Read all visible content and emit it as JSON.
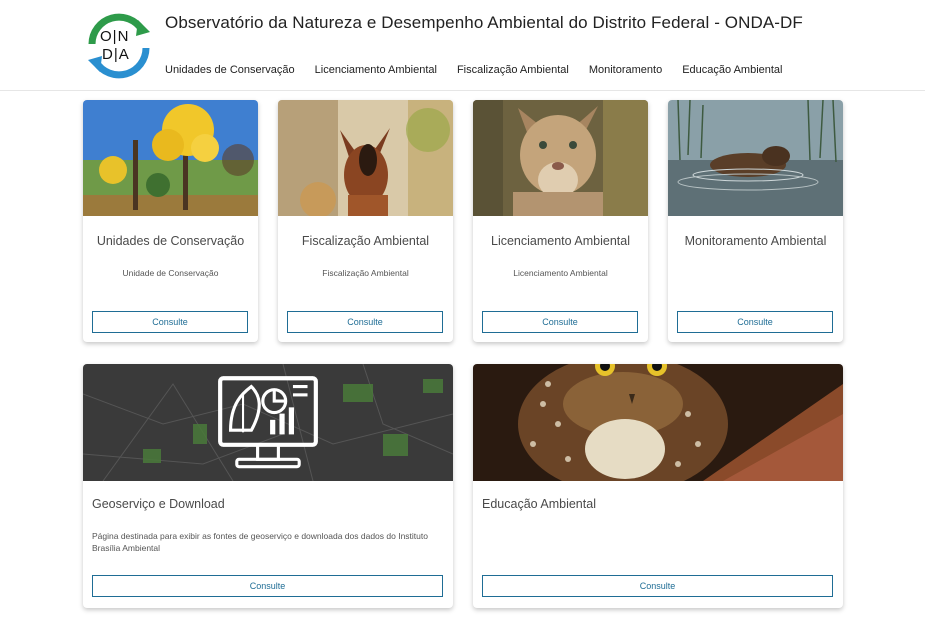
{
  "header": {
    "title": "Observatório da Natureza e Desempenho Ambiental do Distrito Federal - ONDA-DF",
    "logo_text_top": "O|N",
    "logo_text_bottom": "D|A",
    "nav": [
      {
        "label": "Unidades de Conservação"
      },
      {
        "label": "Licenciamento Ambiental"
      },
      {
        "label": "Fiscalização Ambiental"
      },
      {
        "label": "Monitoramento"
      },
      {
        "label": "Educação Ambiental"
      }
    ]
  },
  "cards": [
    {
      "title": "Unidades de Conservação",
      "subtitle": "Unidade de Conservação",
      "button": "Consulte"
    },
    {
      "title": "Fiscalização Ambiental",
      "subtitle": "Fiscalização Ambiental",
      "button": "Consulte"
    },
    {
      "title": "Licenciamento Ambiental",
      "subtitle": "Licenciamento Ambiental",
      "button": "Consulte"
    },
    {
      "title": "Monitoramento Ambiental",
      "subtitle": "",
      "button": "Consulte"
    },
    {
      "title": "Geoserviço e Download",
      "description": "Página destinada para exibir as fontes de geoserviço e downloada dos dados do Instituto Brasília Ambiental",
      "button": "Consulte"
    },
    {
      "title": "Educação Ambiental",
      "description": "",
      "button": "Consulte"
    }
  ],
  "colors": {
    "accent": "#1f6d95",
    "logo_green": "#2e9b4a",
    "logo_blue": "#2a8fd0"
  }
}
